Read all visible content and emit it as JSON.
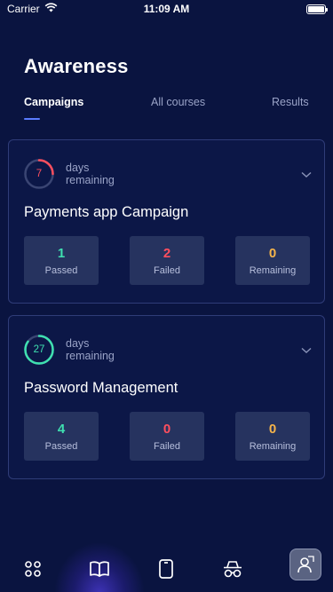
{
  "status": {
    "carrier": "Carrier",
    "time": "11:09 AM"
  },
  "page": {
    "title": "Awareness"
  },
  "tabs": [
    {
      "label": "Campaigns",
      "active": true
    },
    {
      "label": "All courses",
      "active": false
    },
    {
      "label": "Results",
      "active": false
    }
  ],
  "campaigns": [
    {
      "days": "7",
      "days_label_1": "days",
      "days_label_2": "remaining",
      "ring_color": "#ff4f5e",
      "ring_fraction": 0.25,
      "title": "Payments app Campaign",
      "stats": [
        {
          "value": "1",
          "label": "Passed",
          "color": "#3fe0b0"
        },
        {
          "value": "2",
          "label": "Failed",
          "color": "#ff4f5e"
        },
        {
          "value": "0",
          "label": "Remaining",
          "color": "#f5b44a"
        }
      ]
    },
    {
      "days": "27",
      "days_label_1": "days",
      "days_label_2": "remaining",
      "ring_color": "#3fe0b0",
      "ring_fraction": 0.85,
      "title": "Password Management",
      "stats": [
        {
          "value": "4",
          "label": "Passed",
          "color": "#3fe0b0"
        },
        {
          "value": "0",
          "label": "Failed",
          "color": "#ff4f5e"
        },
        {
          "value": "0",
          "label": "Remaining",
          "color": "#f5b44a"
        }
      ]
    }
  ],
  "nav": {
    "items": [
      "grid-icon",
      "book-icon",
      "phone-icon",
      "spy-icon"
    ],
    "active": "book-icon",
    "floating": "user-badge-icon"
  },
  "colors": {
    "background": "#0a1440",
    "card_border": "#2f3c78",
    "stat_bg": "#26335f",
    "accent": "#5b7cff"
  }
}
